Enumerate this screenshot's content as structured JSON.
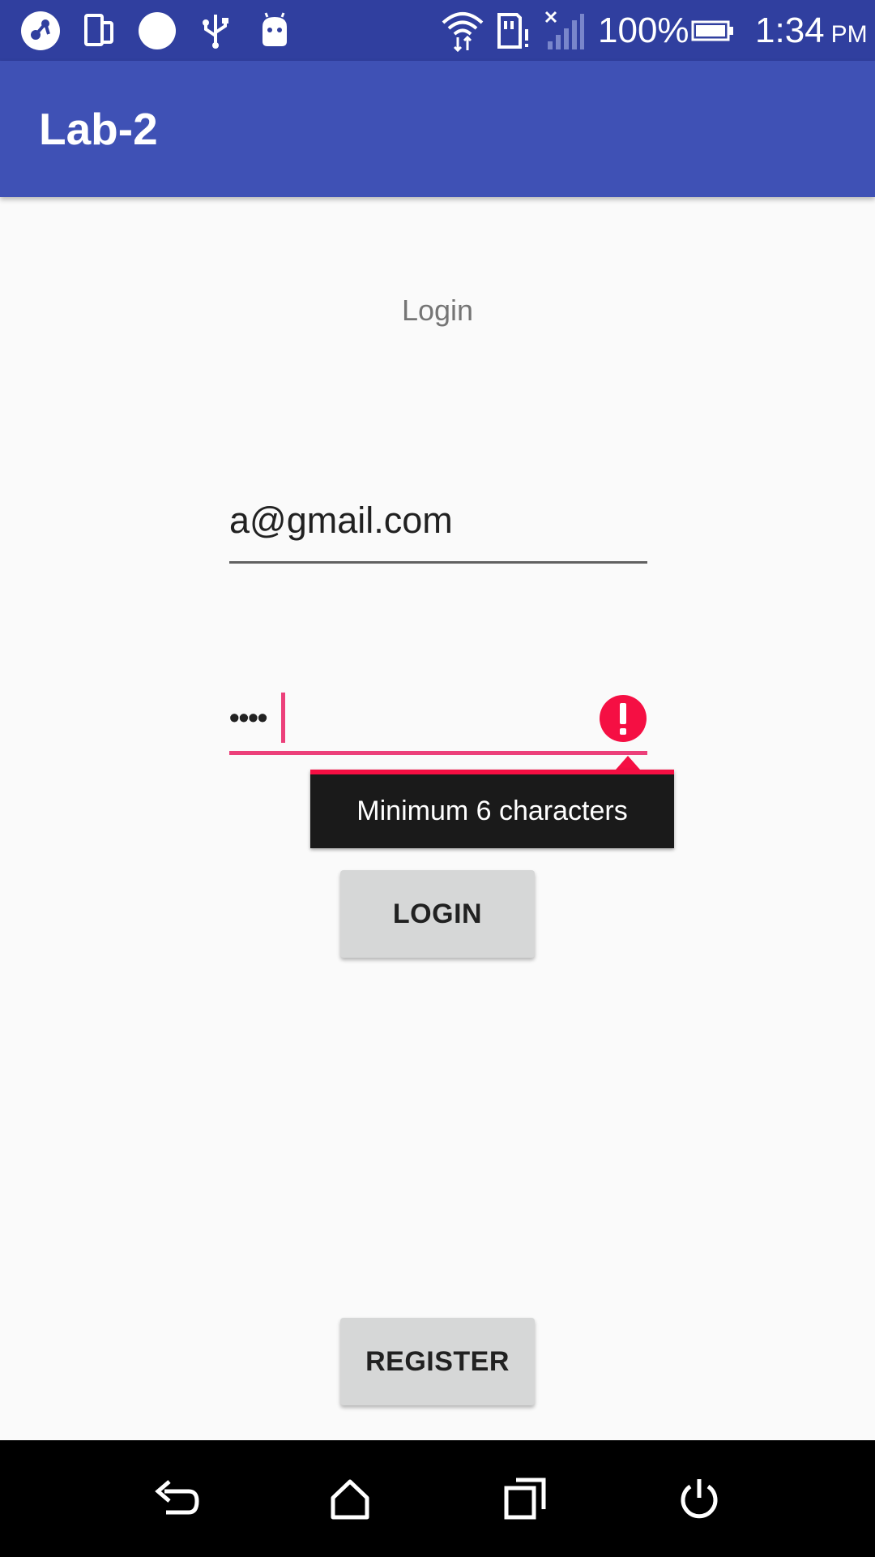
{
  "status_bar": {
    "battery_percent": "100%",
    "time": "1:34",
    "ampm": "PM",
    "icons": [
      "app-icon",
      "phone-rotate-icon",
      "circle-icon",
      "usb-icon",
      "android-icon",
      "wifi-icon",
      "sd-card-icon",
      "signal-icon",
      "battery-icon"
    ]
  },
  "app_bar": {
    "title": "Lab-2"
  },
  "login_form": {
    "heading": "Login",
    "email_value": "a@gmail.com",
    "password_masked": "••••",
    "error_message": "Minimum 6 characters",
    "login_label": "LOGIN"
  },
  "register_label": "REGISTER",
  "nav_bar": {
    "icons": [
      "back-icon",
      "home-icon",
      "recents-icon",
      "power-icon"
    ]
  },
  "colors": {
    "status_bar": "#303f9f",
    "app_bar": "#3f51b5",
    "accent": "#ec407a",
    "error": "#f50f43"
  }
}
